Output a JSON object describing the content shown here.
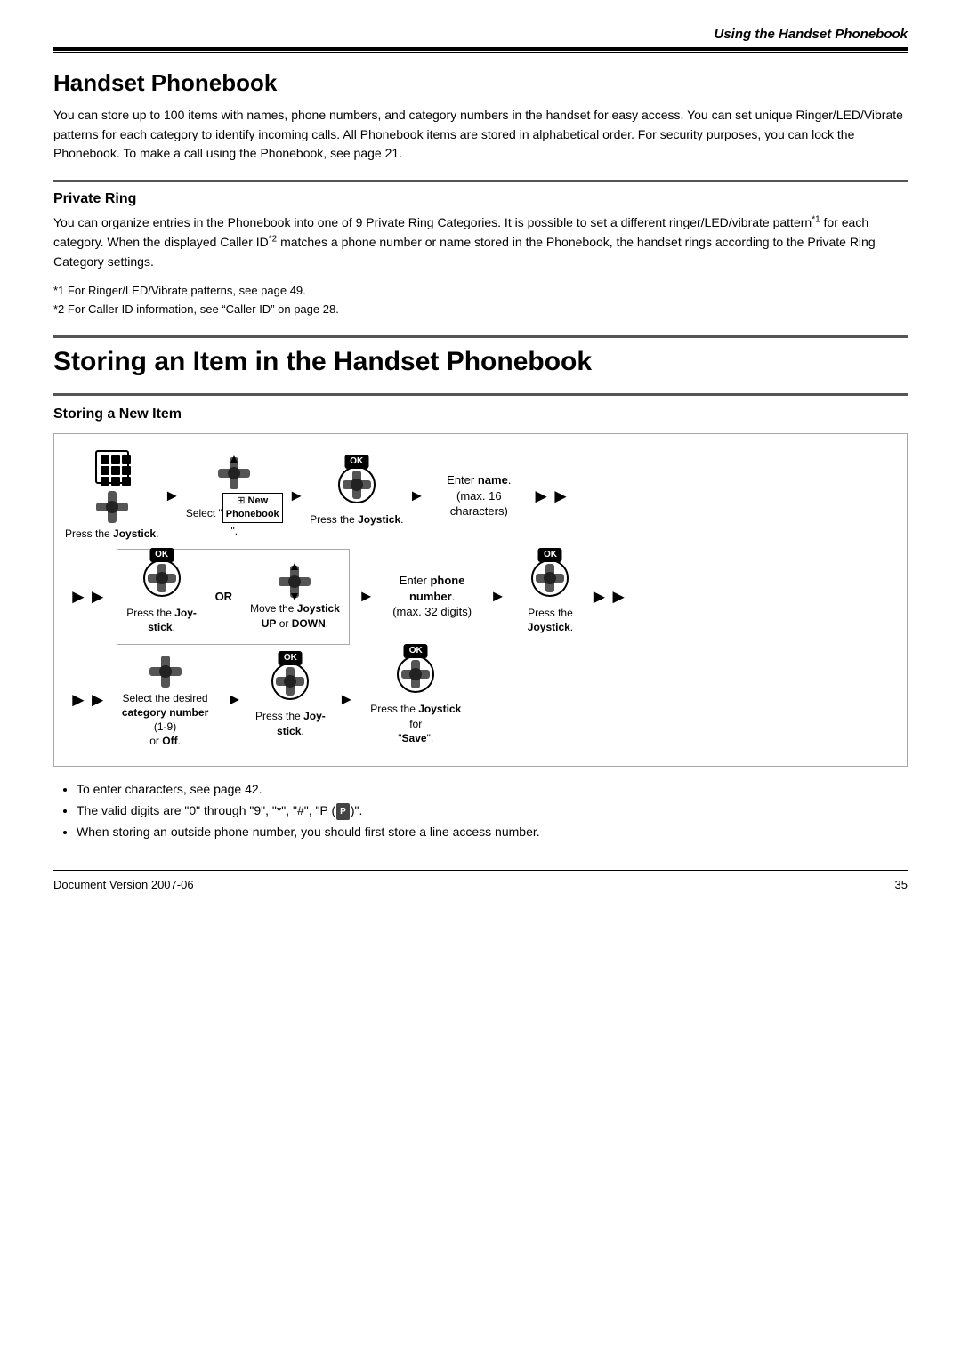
{
  "header": {
    "chapter_title": "Using the Handset Phonebook"
  },
  "section1": {
    "title": "Handset Phonebook",
    "body": "You can store up to 100 items with names, phone numbers, and category numbers in the handset for easy access. You can set unique Ringer/LED/Vibrate patterns for each category to identify incoming calls. All Phonebook items are stored in alphabetical order. For security purposes, you can lock the Phonebook. To make a call using the Phonebook, see page 21.",
    "subsection": {
      "title": "Private Ring",
      "body1": "You can organize entries in the Phonebook into one of 9 Private Ring Categories. It is possible to set a different ringer/LED/vibrate pattern",
      "sup1": "*1",
      "body2": " for each category. When the displayed Caller ID",
      "sup2": "*2",
      "body3": " matches a phone number or name stored in the Phonebook, the handset rings according to the Private Ring Category settings.",
      "footnote1": "*1  For Ringer/LED/Vibrate patterns, see page 49.",
      "footnote2": "*2  For Caller ID information, see “Caller ID” on page 28."
    }
  },
  "section2": {
    "title": "Storing an Item in the Handset Phonebook",
    "storing_new": {
      "title": "Storing a New Item",
      "row1": {
        "step1_label": "Press the Joystick.",
        "step2_label": "Select “⊞ New Phonebook”.",
        "step3_label": "Press the Joystick.",
        "step4_label_pre": "Enter ",
        "step4_label_bold": "name",
        "step4_label_post": ".\n(max. 16 characters)"
      },
      "row2": {
        "or_label": "OR",
        "substep1_label": "Press the Joy-\nstick.",
        "substep2_label": "Move the Joystick\nUP or DOWN.",
        "step_enter_label_pre": "Enter ",
        "step_enter_label_bold": "phone number",
        "step_enter_label_post": ".\n(max. 32 digits)",
        "step_last_label": "Press the\nJoystick."
      },
      "row3": {
        "step1_label_pre": "Select the desired ",
        "step1_label_bold": "category number",
        "step1_label_post": " (1-9)\nor Off.",
        "step2_label_pre": "Press the Joy-\n",
        "step2_label_bold": "stick",
        "step2_label_post": ".",
        "step3_label_pre": "Press the ",
        "step3_label_bold": "Joystick",
        "step3_label_post": " for\n“Save”."
      }
    },
    "bullets": [
      "To enter characters, see page 42.",
      "The valid digits are “0” through “9”, “∗”, “#”, “P (Ⓟ)”.",
      "When storing an outside phone number, you should first store a line access number."
    ]
  },
  "footer": {
    "doc_version": "Document Version 2007-06",
    "page_number": "35"
  }
}
